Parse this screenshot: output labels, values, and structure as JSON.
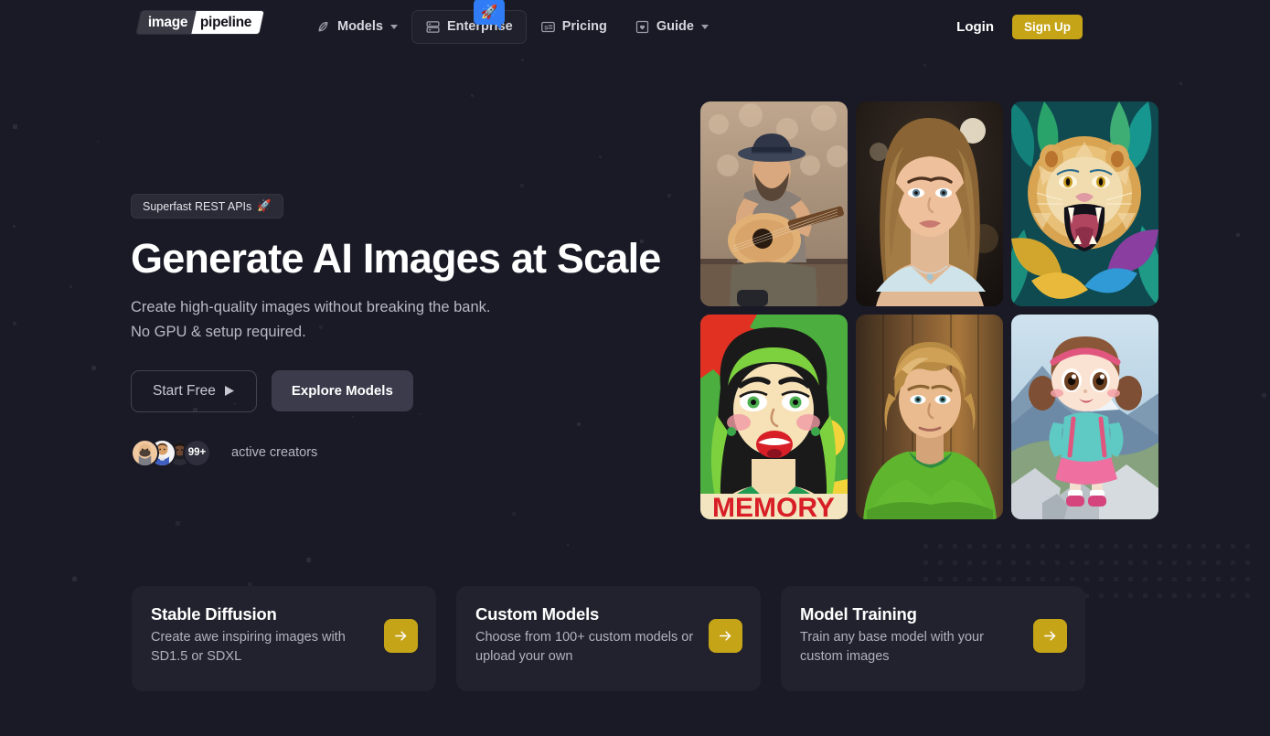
{
  "brand": {
    "logo_left": "image",
    "logo_right": "pipeline"
  },
  "nav": {
    "items": [
      {
        "label": "Models",
        "icon": "leaf-icon",
        "has_caret": true,
        "active": false
      },
      {
        "label": "Enterprise",
        "icon": "server-icon",
        "has_caret": false,
        "active": true
      },
      {
        "label": "Pricing",
        "icon": "price-tag-icon",
        "has_caret": false,
        "active": false
      },
      {
        "label": "Guide",
        "icon": "book-icon",
        "has_caret": true,
        "active": false
      }
    ],
    "enterprise_badge_icon": "rocket-icon",
    "enterprise_badge_emoji": "🚀",
    "enterprise_badge_color": "#2f7cf6",
    "login_label": "Login",
    "signup_label": "Sign Up",
    "signup_color": "#c5a417"
  },
  "hero": {
    "pill_text": "Superfast REST APIs",
    "pill_emoji": "🚀",
    "title": "Generate AI Images at Scale",
    "subtitle_line1": "Create high-quality images without breaking the bank.",
    "subtitle_line2": "No GPU & setup required.",
    "primary_cta": "Start Free",
    "primary_cta_icon": "play-icon",
    "secondary_cta": "Explore Models",
    "creators_count": "99+",
    "creators_label": "active creators"
  },
  "gallery": {
    "images": [
      {
        "alt": "man playing acoustic guitar outdoors wearing a hat",
        "name": "gallery-image-guitarist"
      },
      {
        "alt": "portrait of a young woman with long blonde hair",
        "name": "gallery-image-portrait"
      },
      {
        "alt": "colorful illustrated roaring lion in foliage",
        "name": "gallery-image-lion"
      },
      {
        "alt": "pop art comic woman with green hair",
        "name": "gallery-image-popart"
      },
      {
        "alt": "young blonde man in a green t-shirt",
        "name": "gallery-image-young-man"
      },
      {
        "alt": "3d cartoon girl standing on mountain rocks",
        "name": "gallery-image-cartoon-girl"
      }
    ]
  },
  "feature_cards": [
    {
      "title": "Stable Diffusion",
      "description": "Create awe inspiring images with SD1.5 or SDXL",
      "arrow_icon": "arrow-right-icon"
    },
    {
      "title": "Custom Models",
      "description": "Choose from 100+ custom models or upload your own",
      "arrow_icon": "arrow-right-icon"
    },
    {
      "title": "Model Training",
      "description": "Train any base model with your custom images",
      "arrow_icon": "arrow-right-icon"
    }
  ],
  "theme": {
    "background": "#1a1a26",
    "card_background": "#22222e",
    "accent_gold": "#c5a417",
    "accent_blue": "#2f7cf6",
    "text_primary": "#ffffff",
    "text_muted": "#b2b2bf"
  }
}
